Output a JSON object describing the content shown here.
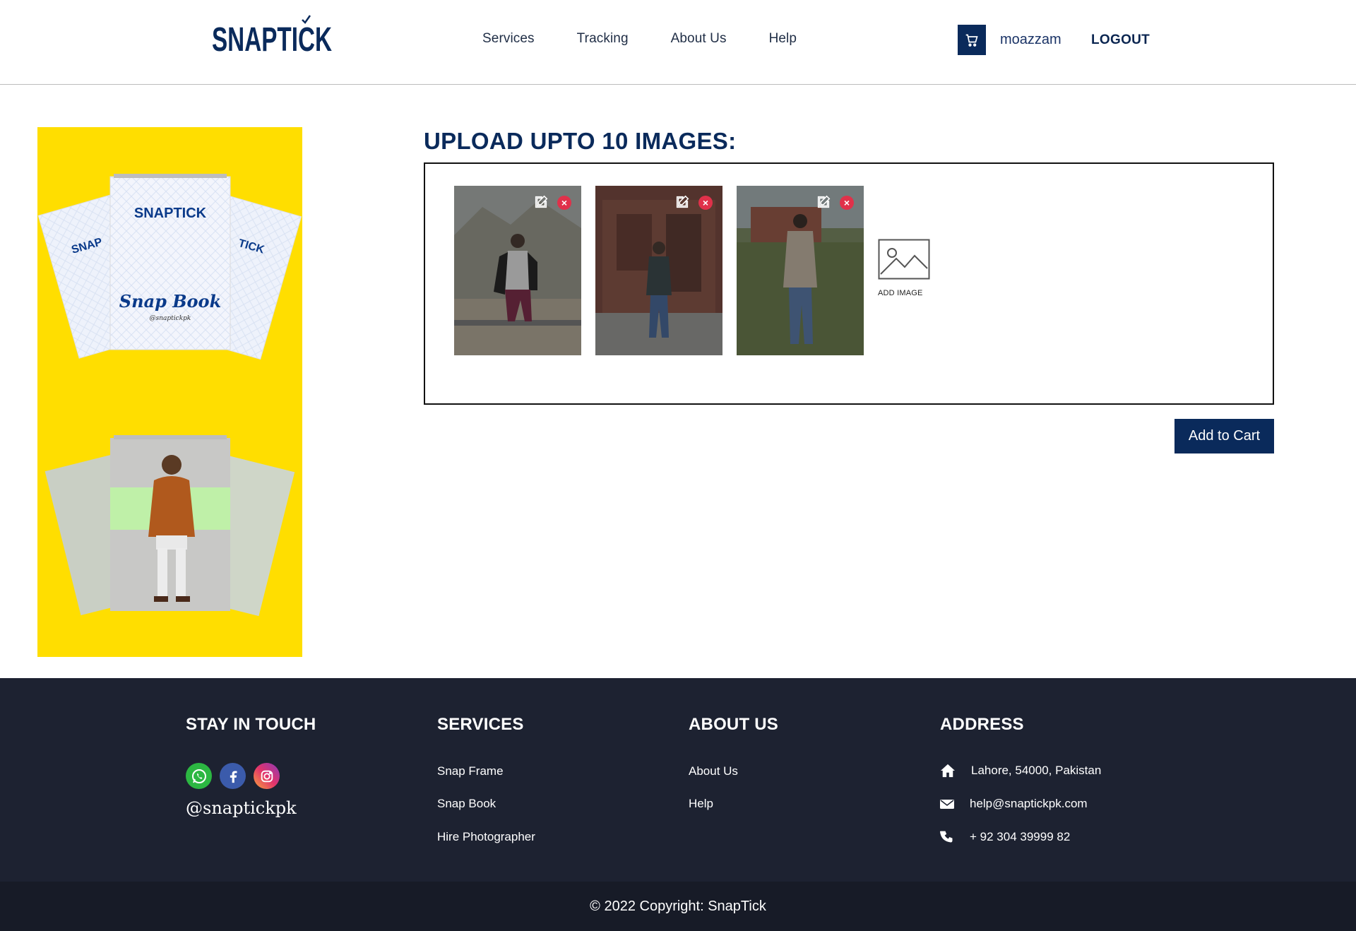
{
  "header": {
    "logo_text": "SNAPTICK",
    "nav": [
      "Services",
      "Tracking",
      "About Us",
      "Help"
    ],
    "username": "moazzam",
    "logout_label": "LOGOUT"
  },
  "banner": {
    "book_brand": "SNAPTICK",
    "book_title": "Snap Book",
    "book_handle": "@snaptickpk"
  },
  "upload": {
    "title": "UPLOAD UPTO 10 IMAGES:",
    "add_image_label": "ADD IMAGE",
    "images": [
      {
        "name": "uploaded-photo-1"
      },
      {
        "name": "uploaded-photo-2"
      },
      {
        "name": "uploaded-photo-3"
      }
    ],
    "add_to_cart_label": "Add to Cart"
  },
  "footer": {
    "stay_in_touch": {
      "heading": "STAY IN TOUCH",
      "social_icons": [
        "whatsapp-icon",
        "facebook-icon",
        "instagram-icon"
      ],
      "handle": "@snaptickpk"
    },
    "services": {
      "heading": "SERVICES",
      "links": [
        "Snap Frame",
        "Snap Book",
        "Hire Photographer"
      ]
    },
    "about": {
      "heading": "ABOUT US",
      "links": [
        "About Us",
        "Help"
      ]
    },
    "address": {
      "heading": "ADDRESS",
      "location": "Lahore, 54000, Pakistan",
      "email": "help@snaptickpk.com",
      "phone": "+ 92 304 39999 82"
    },
    "copyright": "© 2022 Copyright: SnapTick"
  },
  "colors": {
    "brand_navy": "#0a2a5b",
    "banner_yellow": "#ffde00",
    "footer_bg": "#1d2231",
    "delete_red": "#e0314a"
  }
}
